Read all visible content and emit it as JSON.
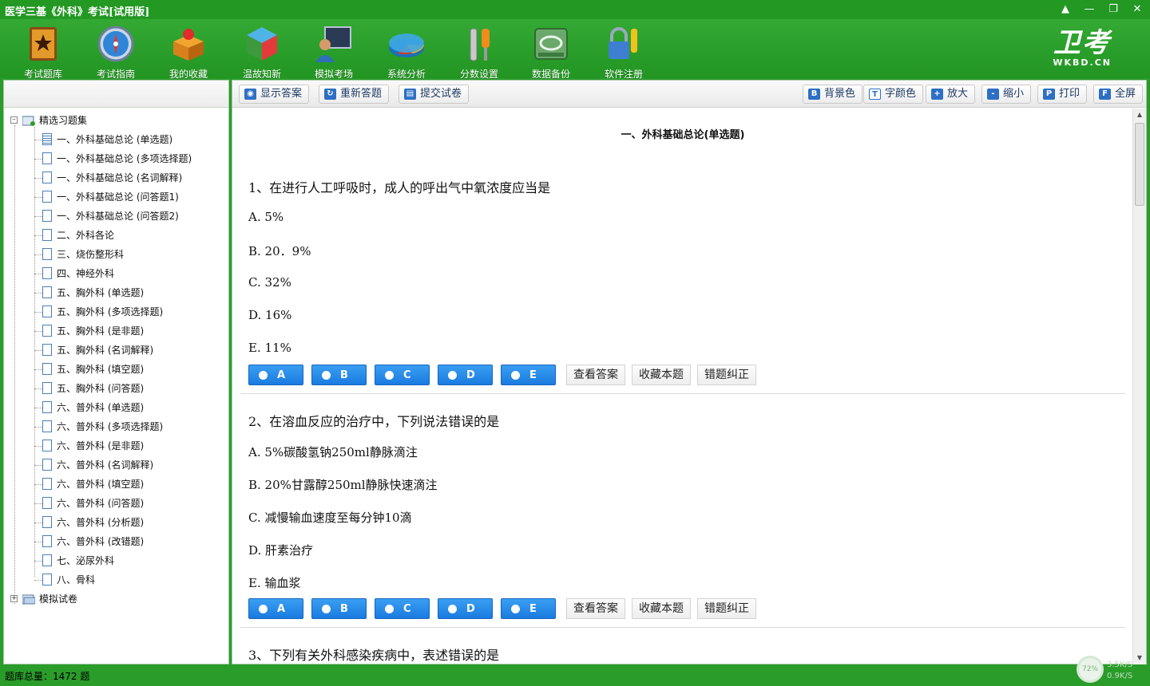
{
  "window": {
    "title": "医学三基《外科》考试[试用版]",
    "controls": [
      "skin",
      "minimize",
      "restore",
      "close"
    ]
  },
  "toolbar": {
    "items": [
      {
        "label": "考试题库",
        "icon": "book-star-icon"
      },
      {
        "label": "考试指南",
        "icon": "compass-icon"
      },
      {
        "label": "我的收藏",
        "icon": "gift-box-icon"
      },
      {
        "label": "温故知新",
        "icon": "cube-icon"
      },
      {
        "label": "模拟考场",
        "icon": "monitor-user-icon"
      },
      {
        "label": "系统分析",
        "icon": "pie-chart-icon"
      },
      {
        "label": "分数设置",
        "icon": "wrench-icon"
      },
      {
        "label": "数据备份",
        "icon": "disk-icon"
      },
      {
        "label": "软件注册",
        "icon": "lock-key-icon"
      }
    ],
    "brand": {
      "big": "卫考",
      "small": "WKBD.CN"
    }
  },
  "tree": {
    "root_label": "精选习题集",
    "items": [
      "一、外科基础总论 (单选题)",
      "一、外科基础总论 (多项选择题)",
      "一、外科基础总论 (名词解释)",
      "一、外科基础总论 (问答题1)",
      "一、外科基础总论 (问答题2)",
      "二、外科各论",
      "三、烧伤整形科",
      "四、神经外科",
      "五、胸外科 (单选题)",
      "五、胸外科 (多项选择题)",
      "五、胸外科 (是非题)",
      "五、胸外科 (名词解释)",
      "五、胸外科 (填空题)",
      "五、胸外科 (问答题)",
      "六、普外科 (单选题)",
      "六、普外科 (多项选择题)",
      "六、普外科 (是非题)",
      "六、普外科 (名词解释)",
      "六、普外科 (填空题)",
      "六、普外科 (问答题)",
      "六、普外科 (分析题)",
      "六、普外科 (改错题)",
      "七、泌尿外科",
      "八、骨科"
    ],
    "selected_index": 0,
    "second_root_label": "模拟试卷"
  },
  "rtoolbar": {
    "left": [
      {
        "label": "显示答案",
        "icon": "eye-icon"
      },
      {
        "label": "重新答题",
        "icon": "refresh-icon"
      },
      {
        "label": "提交试卷",
        "icon": "document-icon"
      }
    ],
    "right": [
      {
        "label": "背景色",
        "icon": "background-color-icon",
        "glyph": "B"
      },
      {
        "label": "字颜色",
        "icon": "text-color-icon",
        "glyph": "T"
      },
      {
        "label": "放大",
        "icon": "zoom-in-icon",
        "glyph": "+"
      },
      {
        "label": "缩小",
        "icon": "zoom-out-icon",
        "glyph": "-"
      },
      {
        "label": "打印",
        "icon": "printer-icon",
        "glyph": "P"
      },
      {
        "label": "全屏",
        "icon": "fullscreen-icon",
        "glyph": "F"
      }
    ]
  },
  "section_title": "一、外科基础总论(单选题)",
  "questions": [
    {
      "text": "1、在进行人工呼吸时，成人的呼出气中氧浓度应当是",
      "options": [
        "A.  5%",
        "B.  20．9%",
        "C.  32%",
        "D.  16%",
        "E.  11%"
      ]
    },
    {
      "text": "2、在溶血反应的治疗中，下列说法错误的是",
      "options": [
        "A.  5%碳酸氢钠250ml静脉滴注",
        "B.  20%甘露醇250ml静脉快速滴注",
        "C.  减慢输血速度至每分钟10滴",
        "D.  肝素治疗",
        "E.  输血浆"
      ]
    },
    {
      "text": "3、下列有关外科感染疾病中，表述错误的是",
      "options": []
    }
  ],
  "answer_labels": [
    "A",
    "B",
    "C",
    "D",
    "E"
  ],
  "action_labels": {
    "view": "查看答案",
    "favorite": "收藏本题",
    "report": "错题纠正"
  },
  "status": {
    "count_text": "题库总量：1472 题"
  },
  "network": {
    "percent": "72%",
    "up": "3.5K/S",
    "down": "0.9K/S"
  }
}
